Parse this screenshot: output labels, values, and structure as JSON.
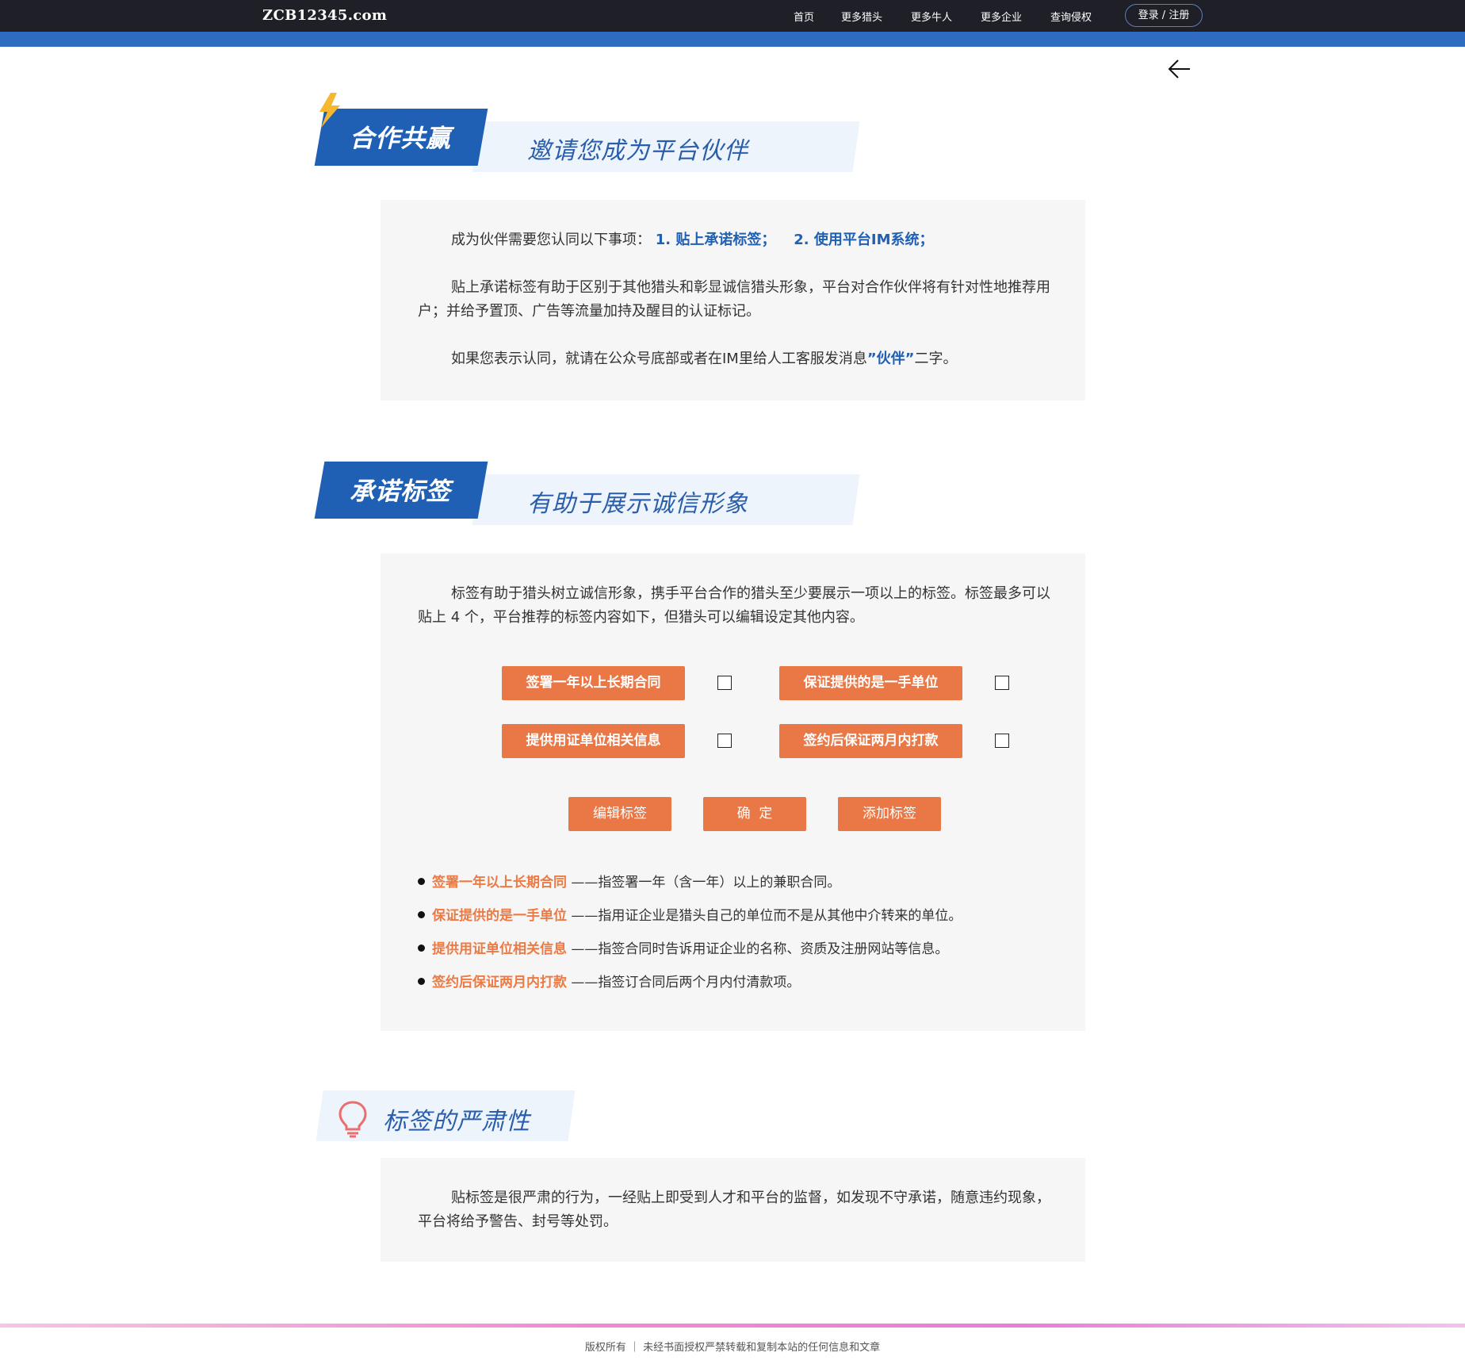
{
  "header": {
    "brand": "ZCB12345.com",
    "nav": [
      "首页",
      "更多猎头",
      "更多牛人",
      "更多企业",
      "查询侵权"
    ],
    "login": "登录 / 注册"
  },
  "section1": {
    "title": "合作共赢",
    "subtitle": "邀请您成为平台伙伴",
    "line1_prefix": "成为伙伴需要您认同以下事项：",
    "line1_item1": "1. 贴上承诺标签；",
    "line1_item2": "2. 使用平台IM系统；",
    "para2": "贴上承诺标签有助于区别于其他猎头和彰显诚信猎头形象，平台对合作伙伴将有针对性地推荐用户；并给予置顶、广告等流量加持及醒目的认证标记。",
    "para3_prefix": "如果您表示认同，就请在公众号底部或者在IM里给人工客服发消息",
    "para3_highlight": "”伙伴”",
    "para3_suffix": "二字。"
  },
  "section2": {
    "title": "承诺标签",
    "subtitle": "有助于展示诚信形象",
    "intro": "标签有助于猎头树立诚信形象，携手平台合作的猎头至少要展示一项以上的标签。标签最多可以贴上 4 个，平台推荐的标签内容如下，但猎头可以编辑设定其他内容。",
    "tags": [
      "签署一年以上长期合同",
      "保证提供的是一手单位",
      "提供用证单位相关信息",
      "签约后保证两月内打款"
    ],
    "buttons": {
      "edit": "编辑标签",
      "confirm": "确  定",
      "add": "添加标签"
    },
    "bullets": [
      {
        "term": "签署一年以上长期合同",
        "desc": "——指签署一年（含一年）以上的兼职合同。"
      },
      {
        "term": "保证提供的是一手单位",
        "desc": "——指用证企业是猎头自己的单位而不是从其他中介转来的单位。"
      },
      {
        "term": "提供用证单位相关信息",
        "desc": "——指签合同时告诉用证企业的名称、资质及注册网站等信息。"
      },
      {
        "term": "签约后保证两月内打款",
        "desc": "——指签订合同后两个月内付清款项。"
      }
    ]
  },
  "section3": {
    "subtitle": "标签的严肃性",
    "para": "贴标签是很严肃的行为，一经贴上即受到人才和平台的监督，如发现不守承诺，随意违约现象，平台将给予警告、封号等处罚。"
  },
  "footer": {
    "text": "版权所有 ｜ 未经书面授权严禁转载和复制本站的任何信息和文章"
  }
}
